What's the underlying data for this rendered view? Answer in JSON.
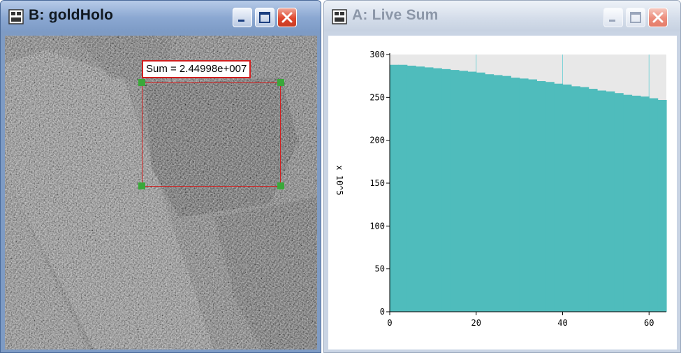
{
  "window_b": {
    "title": "B: goldHolo",
    "roi_label": "Sum = 2.44998e+007"
  },
  "window_a": {
    "title": "A: Live Sum",
    "y_axis_label": "x 10^5"
  },
  "colors": {
    "fill": "#4fbcbc",
    "title_active": "#101820",
    "title_inactive": "#8c97a8",
    "roi": "#d21e1e",
    "handle": "#3aa83a"
  },
  "chart_data": {
    "type": "area",
    "x": [
      0,
      2,
      4,
      6,
      8,
      10,
      12,
      14,
      16,
      18,
      20,
      22,
      24,
      26,
      28,
      30,
      32,
      34,
      36,
      38,
      40,
      42,
      44,
      46,
      48,
      50,
      52,
      54,
      56,
      58,
      60,
      62,
      64
    ],
    "values": [
      288,
      288,
      287,
      286,
      285,
      284,
      283,
      282,
      281,
      280,
      279,
      277,
      276,
      275,
      273,
      272,
      271,
      269,
      268,
      266,
      265,
      263,
      262,
      260,
      258,
      257,
      255,
      253,
      252,
      251,
      249,
      247,
      246
    ],
    "xlim": [
      0,
      64
    ],
    "ylim": [
      0,
      300
    ],
    "xticks": [
      "0",
      "20",
      "40",
      "60"
    ],
    "yticks": [
      "0",
      "50",
      "100",
      "150",
      "200",
      "250",
      "300"
    ],
    "ylabel": "x 10^5",
    "grid": false
  }
}
